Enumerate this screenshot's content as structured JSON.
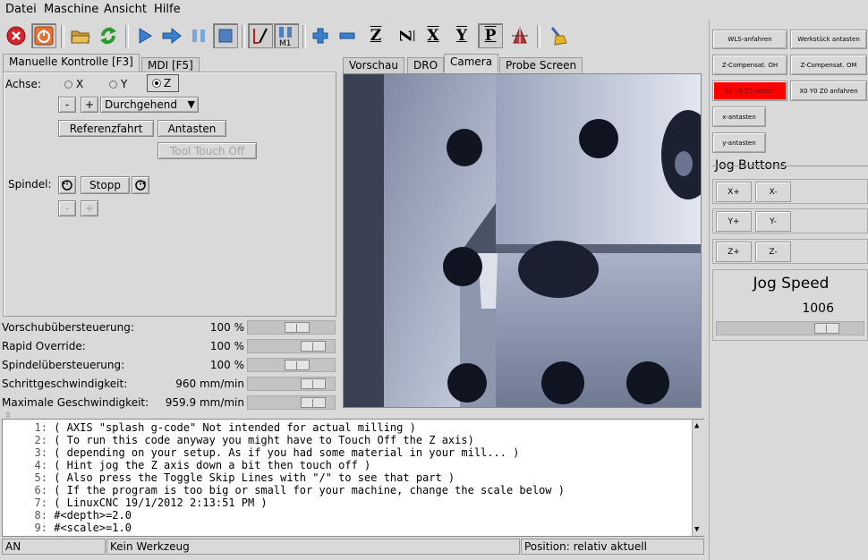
{
  "menu": [
    "Datei",
    "Maschine",
    "Ansicht",
    "Hilfe"
  ],
  "toolbar": {
    "icons": [
      "estop-icon",
      "power-icon",
      "open-file-icon",
      "reload-icon",
      "run-icon",
      "step-icon",
      "pause-icon",
      "stop-icon",
      "skip-lines-icon",
      "optional-stop-icon",
      "zoom-in-icon",
      "zoom-out-icon",
      "view-z-icon",
      "view-rotated-z-icon",
      "view-x-icon",
      "view-y-icon",
      "view-p-icon",
      "toggle-view-icon",
      "clear-plot-icon"
    ],
    "z_letter": "Z",
    "z2_letter": "Z",
    "x_letter": "X",
    "y_letter": "Y",
    "p_letter": "P",
    "m1_label": "M1"
  },
  "left_tabs": [
    "Manuelle Kontrolle [F3]",
    "MDI [F5]"
  ],
  "manual": {
    "axis_label": "Achse:",
    "axes": [
      "X",
      "Y",
      "Z"
    ],
    "selected_axis": "Z",
    "minus": "-",
    "plus": "+",
    "jog_mode": "Durchgehend",
    "home_button": "Referenzfahrt",
    "touch_button": "Antasten",
    "tool_touch_off": "Tool Touch Off",
    "spindle_label": "Spindel:",
    "spindle_stop": "Stopp",
    "spindle_minus": "-",
    "spindle_plus": "+"
  },
  "overrides": [
    {
      "label": "Vorschubübersteuerung:",
      "value": "100 %",
      "fraction": 0.6
    },
    {
      "label": "Rapid Override:",
      "value": "100 %",
      "fraction": 0.85
    },
    {
      "label": "Spindelübersteuerung:",
      "value": "100 %",
      "fraction": 0.6
    },
    {
      "label": "Schrittgeschwindigkeit:",
      "value": "960 mm/min",
      "fraction": 0.85
    },
    {
      "label": "Maximale Geschwindigkeit:",
      "value": "959.9 mm/min",
      "fraction": 0.85
    }
  ],
  "view_tabs": [
    "Vorschau",
    "DRO",
    "Camera",
    "Probe Screen"
  ],
  "active_view_tab": "Camera",
  "gcode": [
    {
      "n": "1:",
      "text": "( AXIS \"splash g-code\" Not intended for actual milling )"
    },
    {
      "n": "2:",
      "text": "( To run this code anyway you might have to Touch Off the Z axis)"
    },
    {
      "n": "3:",
      "text": "( depending on your setup. As if you had some material in your mill... )"
    },
    {
      "n": "4:",
      "text": "( Hint jog the Z axis down a bit then touch off )"
    },
    {
      "n": "5:",
      "text": "( Also press the Toggle Skip Lines with \"/\" to see that part )"
    },
    {
      "n": "6:",
      "text": "( If the program is too big or small for your machine, change the scale below )"
    },
    {
      "n": "7:",
      "text": "( LinuxCNC 19/1/2012 2:13:51 PM )"
    },
    {
      "n": "8:",
      "text": "#<depth>=2.0"
    },
    {
      "n": "9:",
      "text": "#<scale>=1.0"
    }
  ],
  "status": {
    "state": "AN",
    "tool": "Kein Werkzeug",
    "position": "Position: relativ aktuell"
  },
  "right": {
    "buttons": [
      "WLS-anfahren",
      "Werkstück antasten",
      "Z-Compensat. OH",
      "Z-Compensat. OM",
      "X0 Y0 Z0 setzen",
      "X0 Y0 Z0 anfahren",
      "x-antasten",
      "y-antasten"
    ],
    "jog_title": "Jog Buttons",
    "jog": [
      "X+",
      "X-",
      "Y+",
      "Y-",
      "Z+",
      "Z-"
    ],
    "jog_speed_label": "Jog Speed",
    "jog_speed_value": "1006",
    "jog_speed_fraction": 0.8,
    "highlight_color": "#ff0000"
  }
}
